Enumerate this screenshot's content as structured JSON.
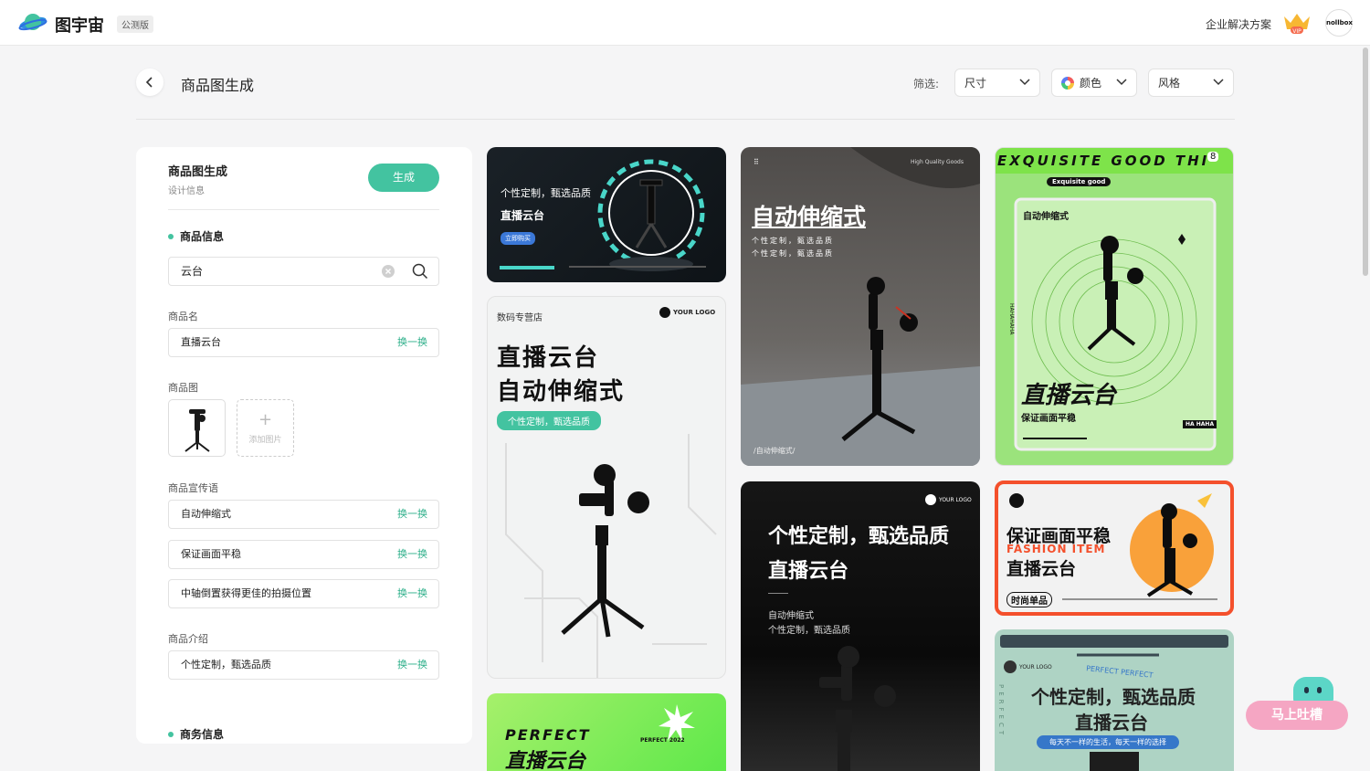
{
  "header": {
    "brand": "图宇宙",
    "beta": "公测版",
    "enterprise": "企业解决方案",
    "avatar": "nollbox"
  },
  "page": {
    "title": "商品图生成"
  },
  "filters": {
    "label": "筛选:",
    "size": "尺寸",
    "color": "颜色",
    "style": "风格"
  },
  "panel": {
    "title": "商品图生成",
    "subtitle": "设计信息",
    "generate": "生成",
    "product_info": "商品信息",
    "search_value": "云台",
    "name_label": "商品名",
    "name_value": "直播云台",
    "image_label": "商品图",
    "add_image": "添加图片",
    "slogan_label": "商品宣传语",
    "slogans": [
      "自动伸缩式",
      "保证画面平稳",
      "中轴倒置获得更佳的拍摄位置"
    ],
    "intro_label": "商品介绍",
    "intro_value": "个性定制，甄选品质",
    "business_info": "商务信息",
    "swap": "换一换"
  },
  "cards": {
    "c1": {
      "line1": "个性定制，甄选品质",
      "line2": "直播云台",
      "btn": "立即购买"
    },
    "c2": {
      "shop": "数码专营店",
      "logo": "YOUR LOGO",
      "title1": "直播云台",
      "title2": "自动伸缩式",
      "pill": "个性定制，甄选品质"
    },
    "c3": {
      "title": "PERFECT",
      "sub": "直播云台",
      "tag": "PERFECT 2022"
    },
    "c4": {
      "top": "High Quality Goods",
      "title": "自动伸缩式",
      "l1": "个性定制，甄选品质",
      "l2": "个性定制，甄选品质",
      "foot": "/自动伸缩式/"
    },
    "c5": {
      "logo": "YOUR LOGO",
      "t1": "个性定制，甄选品质",
      "t2": "直播云台",
      "l1": "自动伸缩式",
      "l2": "个性定制，甄选品质"
    },
    "c6": {
      "marquee": "EXQUISITE GOOD THI",
      "badge": "8",
      "sub": "Exquisite good",
      "side": "HAHAHAHA",
      "box": "自动伸缩式",
      "title": "直播云台",
      "caption": "保证画面平稳",
      "tag": "HA HAHA"
    },
    "c7": {
      "t1": "保证画面平稳",
      "fashion": "FASHION ITEM",
      "t2": "直播云台",
      "tag": "时尚单品"
    },
    "c8": {
      "logo": "YOUR LOGO",
      "arc": "PERFECT PERFECT",
      "t1": "个性定制，甄选品质",
      "t2": "直播云台",
      "band": "每天不一样的生活，每天一样的选择",
      "side": "PERFECT"
    }
  },
  "feedback": "马上吐槽"
}
